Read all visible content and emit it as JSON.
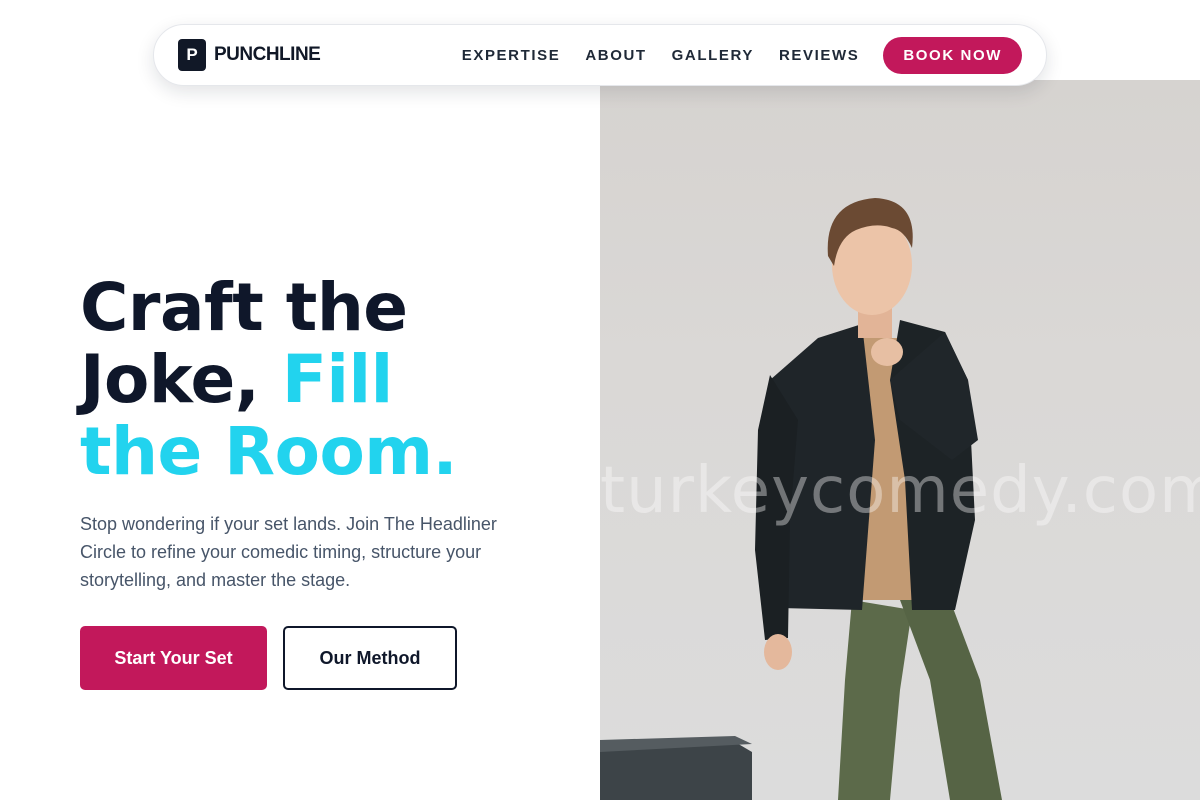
{
  "brand": {
    "logo_letter": "P",
    "name": "PUNCHLINE"
  },
  "nav": {
    "links": [
      "EXPERTISE",
      "ABOUT",
      "GALLERY",
      "REVIEWS"
    ],
    "cta": "BOOK NOW"
  },
  "hero": {
    "headline_line1": "Craft the",
    "headline_line2_dark": "Joke,",
    "headline_line2_accent": "Fill",
    "headline_line3_accent": "the Room.",
    "subtext": "Stop wondering if your set lands. Join The Headliner Circle to refine your comedic timing, structure your storytelling, and master the stage.",
    "primary_button": "Start Your Set",
    "secondary_button": "Our Method",
    "watermark": "turkeycomedy.com"
  },
  "colors": {
    "brand_magenta": "#c2185b",
    "accent_cyan": "#22d3ee",
    "heading_navy": "#0f172a",
    "body_gray": "#475569"
  },
  "icons": {
    "photo": "man-in-black-blazer-photo"
  }
}
